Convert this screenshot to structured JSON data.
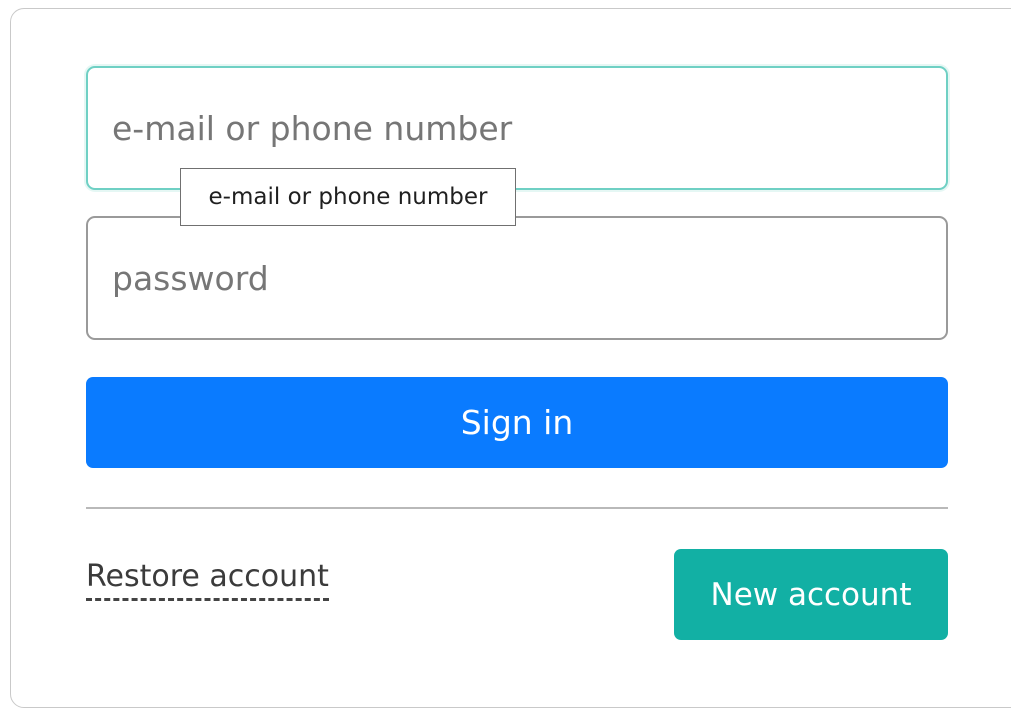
{
  "login": {
    "email": {
      "placeholder": "e-mail or phone number",
      "value": "",
      "tooltip": "e-mail or phone number"
    },
    "password": {
      "placeholder": "password",
      "value": ""
    },
    "sign_in_label": "Sign in",
    "restore_label": "Restore account",
    "new_account_label": "New account"
  },
  "colors": {
    "primary": "#0a7bff",
    "accent": "#12b0a4",
    "focus_border": "#6fd0c4"
  }
}
